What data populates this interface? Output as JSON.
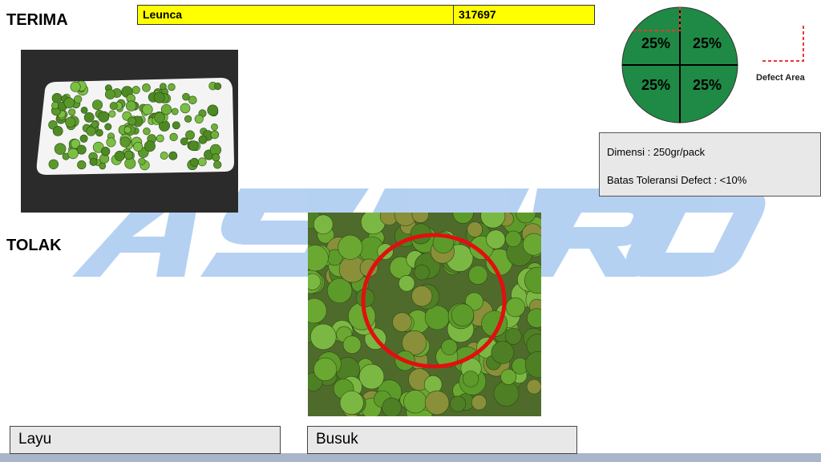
{
  "headings": {
    "accept": "TERIMA",
    "reject": "TOLAK"
  },
  "product": {
    "name": "Leunca",
    "code": "317697",
    "bar_color": "#ffff00"
  },
  "defect_chart": {
    "quadrants": [
      "25%",
      "25%",
      "25%",
      "25%"
    ],
    "legend_label": "Defect Area",
    "fill_color": "#1f8a45",
    "marker_color": "#e53935"
  },
  "spec": {
    "dimension": "Dimensi : 250gr/pack",
    "tolerance": "Batas Toleransi Defect : <10%"
  },
  "captions": {
    "wilted": "Layu",
    "rotten": "Busuk"
  },
  "watermark": {
    "text": "ASTRO",
    "color": "#9fc3ee"
  },
  "photos": {
    "accept": "leunca-on-white-tray",
    "reject": "rotten-leunca-with-red-circle",
    "highlight_color": "#e01010"
  }
}
